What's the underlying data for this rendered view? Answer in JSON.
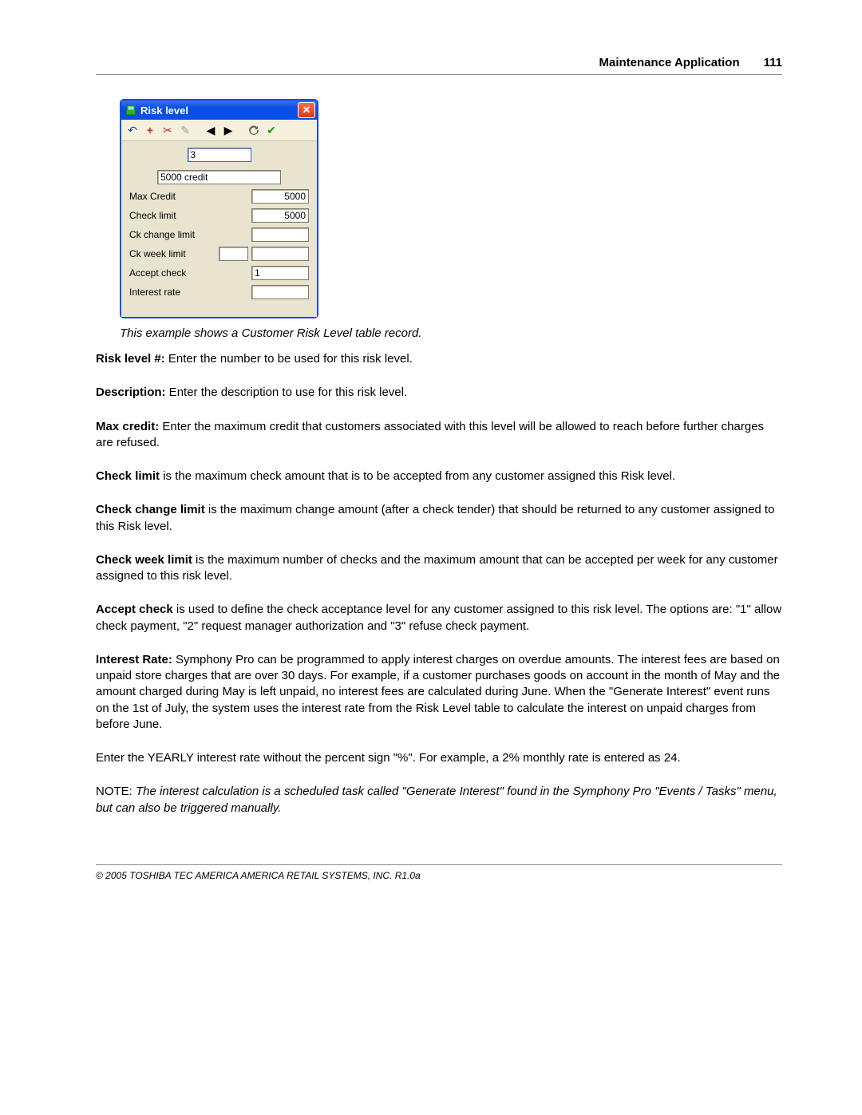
{
  "header": {
    "title": "Maintenance Application",
    "page": "111"
  },
  "dialog": {
    "title": "Risk level",
    "toolbar_icons": [
      "undo-icon",
      "add-icon",
      "cut-icon",
      "edit-icon",
      "prev-icon",
      "next-icon",
      "refresh-icon",
      "ok-icon"
    ],
    "top_code": "3",
    "desc_value": "5000 credit",
    "fields": {
      "max_credit": {
        "label": "Max Credit",
        "value": "5000"
      },
      "check_limit": {
        "label": "Check limit",
        "value": "5000"
      },
      "ck_change": {
        "label": "Ck change limit",
        "value": ""
      },
      "ck_week": {
        "label": "Ck week limit",
        "value_a": "",
        "value_b": ""
      },
      "accept_check": {
        "label": "Accept check",
        "value": "1"
      },
      "interest": {
        "label": "Interest rate",
        "value": ""
      }
    }
  },
  "caption": "This example shows a Customer Risk Level table record.",
  "body": {
    "risk_level_num": {
      "label": "Risk level #:",
      "text": "  Enter the number to be used for this risk level."
    },
    "description": {
      "label": "Description:",
      "text": "  Enter the description to use for this risk level."
    },
    "max_credit": {
      "label": "Max credit:",
      "text": "  Enter the maximum credit that customers associated with this level will be allowed to reach before further charges are refused."
    },
    "check_limit": {
      "label": "Check limit",
      "text": "  is the maximum check amount that is to be accepted from any customer assigned this Risk level."
    },
    "check_change": {
      "label": "Check change limit",
      "text": "  is the maximum change amount (after a check tender) that should be returned to any customer assigned to this Risk level."
    },
    "check_week": {
      "label": "Check week limit",
      "text": "  is the maximum number of checks and the maximum amount that can be accepted per week for any customer assigned to this risk level."
    },
    "accept_check": {
      "label": "Accept check",
      "text": "  is used to define the check acceptance level for any customer assigned to this risk level. The options are: \"1\" allow check payment, \"2\" request manager authorization and \"3\" refuse check payment."
    },
    "interest": {
      "label": "Interest Rate:",
      "text": "  Symphony Pro can be programmed to apply interest charges on overdue amounts. The interest fees are based on unpaid store charges that are over 30 days. For example, if a customer purchases goods on account in the month of May and the amount charged during May is left unpaid, no interest fees are calculated during June. When the \"Generate Interest\" event runs on the 1st of July, the system uses the interest rate from the Risk Level table to calculate the interest on unpaid charges from before June."
    },
    "yearly": " Enter the YEARLY  interest rate without  the percent sign \"%\". For example, a 2% monthly rate is entered as 24.",
    "note_label": "NOTE:",
    "note_text": " The interest calculation is a scheduled task called  \"Generate Interest\"  found in the Symphony Pro \"Events / Tasks\" menu, but can also be triggered manually."
  },
  "footer": "© 2005 TOSHIBA TEC AMERICA AMERICA RETAIL SYSTEMS, INC.   R1.0a"
}
